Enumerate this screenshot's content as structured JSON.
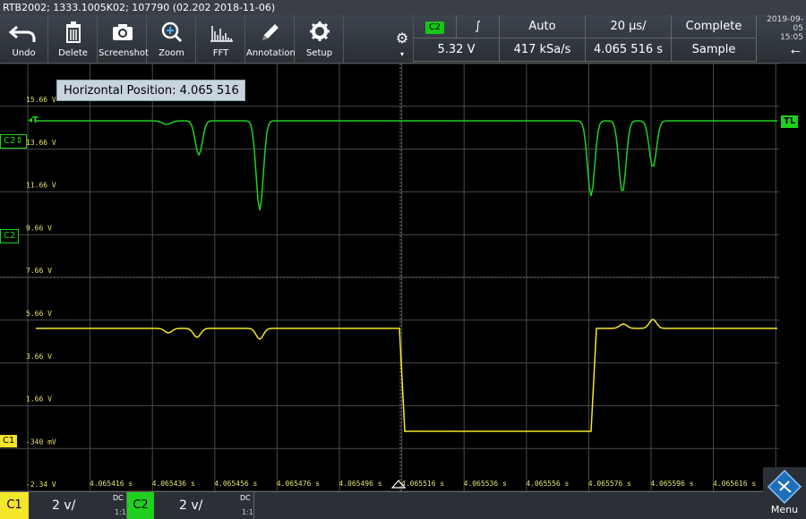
{
  "title_bar": "RTB2002; 1333.1005K02; 107790 (02.202 2018-11-06)",
  "toolbar": {
    "buttons": [
      {
        "label": "Undo",
        "icon": "undo-icon"
      },
      {
        "label": "Delete",
        "icon": "trash-icon"
      },
      {
        "label": "Screenshot",
        "icon": "camera-icon"
      },
      {
        "label": "Zoom",
        "icon": "zoom-in-icon"
      },
      {
        "label": "FFT",
        "icon": "fft-icon"
      },
      {
        "label": "Annotation",
        "icon": "pencil-icon"
      },
      {
        "label": "Setup",
        "icon": "gear-icon"
      }
    ]
  },
  "status": {
    "trigger_source": "C2",
    "trigger_slope": "∫",
    "trigger_mode": "Auto",
    "timebase": "20 µs/",
    "acq_state": "Complete",
    "trigger_level": "5.32 V",
    "sample_rate": "417 kSa/s",
    "position": "4.065 516 s",
    "acq_mode": "Sample"
  },
  "datetime": {
    "date": "2019-09-05",
    "time": "15:05"
  },
  "horizontal_position_tip": "Horizontal Position: 4.065 516 s",
  "y_labels": [
    "15.66 V",
    "13.66 V",
    "11.66 V",
    "9.66 V",
    "7.66 V",
    "5.66 V",
    "3.66 V",
    "1.66 V",
    "-340 mV",
    "-2.34 V"
  ],
  "x_labels": [
    "4.065416 s",
    "4.065436 s",
    "4.065456 s",
    "4.065476 s",
    "4.065496 s",
    "4.065516 s",
    "4.065536 s",
    "4.065556 s",
    "4.065576 s",
    "4.065596 s",
    "4.065616 s"
  ],
  "markers": {
    "c1": "C1",
    "c2": "C2",
    "c2_offset": "C2⇕",
    "trigger": "T",
    "trigger_level": "TL"
  },
  "channels": [
    {
      "name": "C1",
      "scale": "2 v/",
      "coupling": "DC",
      "ratio": "1:1",
      "color": "#f5e62a"
    },
    {
      "name": "C2",
      "scale": "2 v/",
      "coupling": "DC",
      "ratio": "1:1",
      "color": "#1fd01f"
    }
  ],
  "menu_label": "Menu"
}
